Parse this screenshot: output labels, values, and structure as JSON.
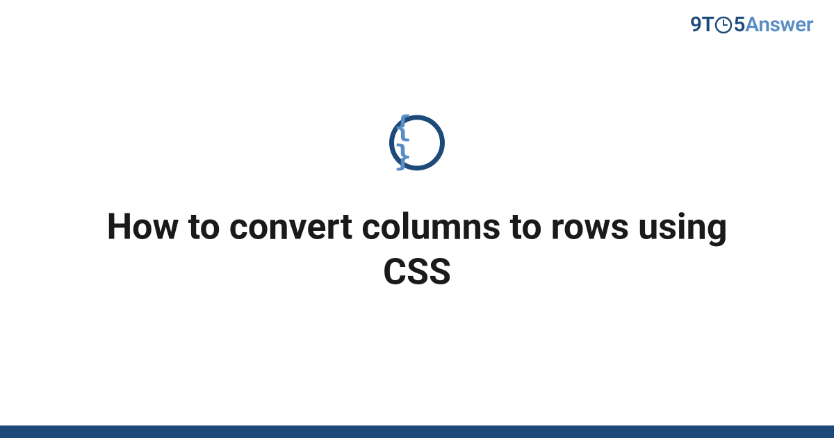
{
  "brand": {
    "part1": "9T",
    "part2": "5",
    "part3": "Answer"
  },
  "icon": {
    "name": "code-braces",
    "symbol": "{ }"
  },
  "title": "How to convert columns to rows using CSS",
  "colors": {
    "brand_dark": "#1e4a7a",
    "brand_light": "#5a8dc4"
  }
}
